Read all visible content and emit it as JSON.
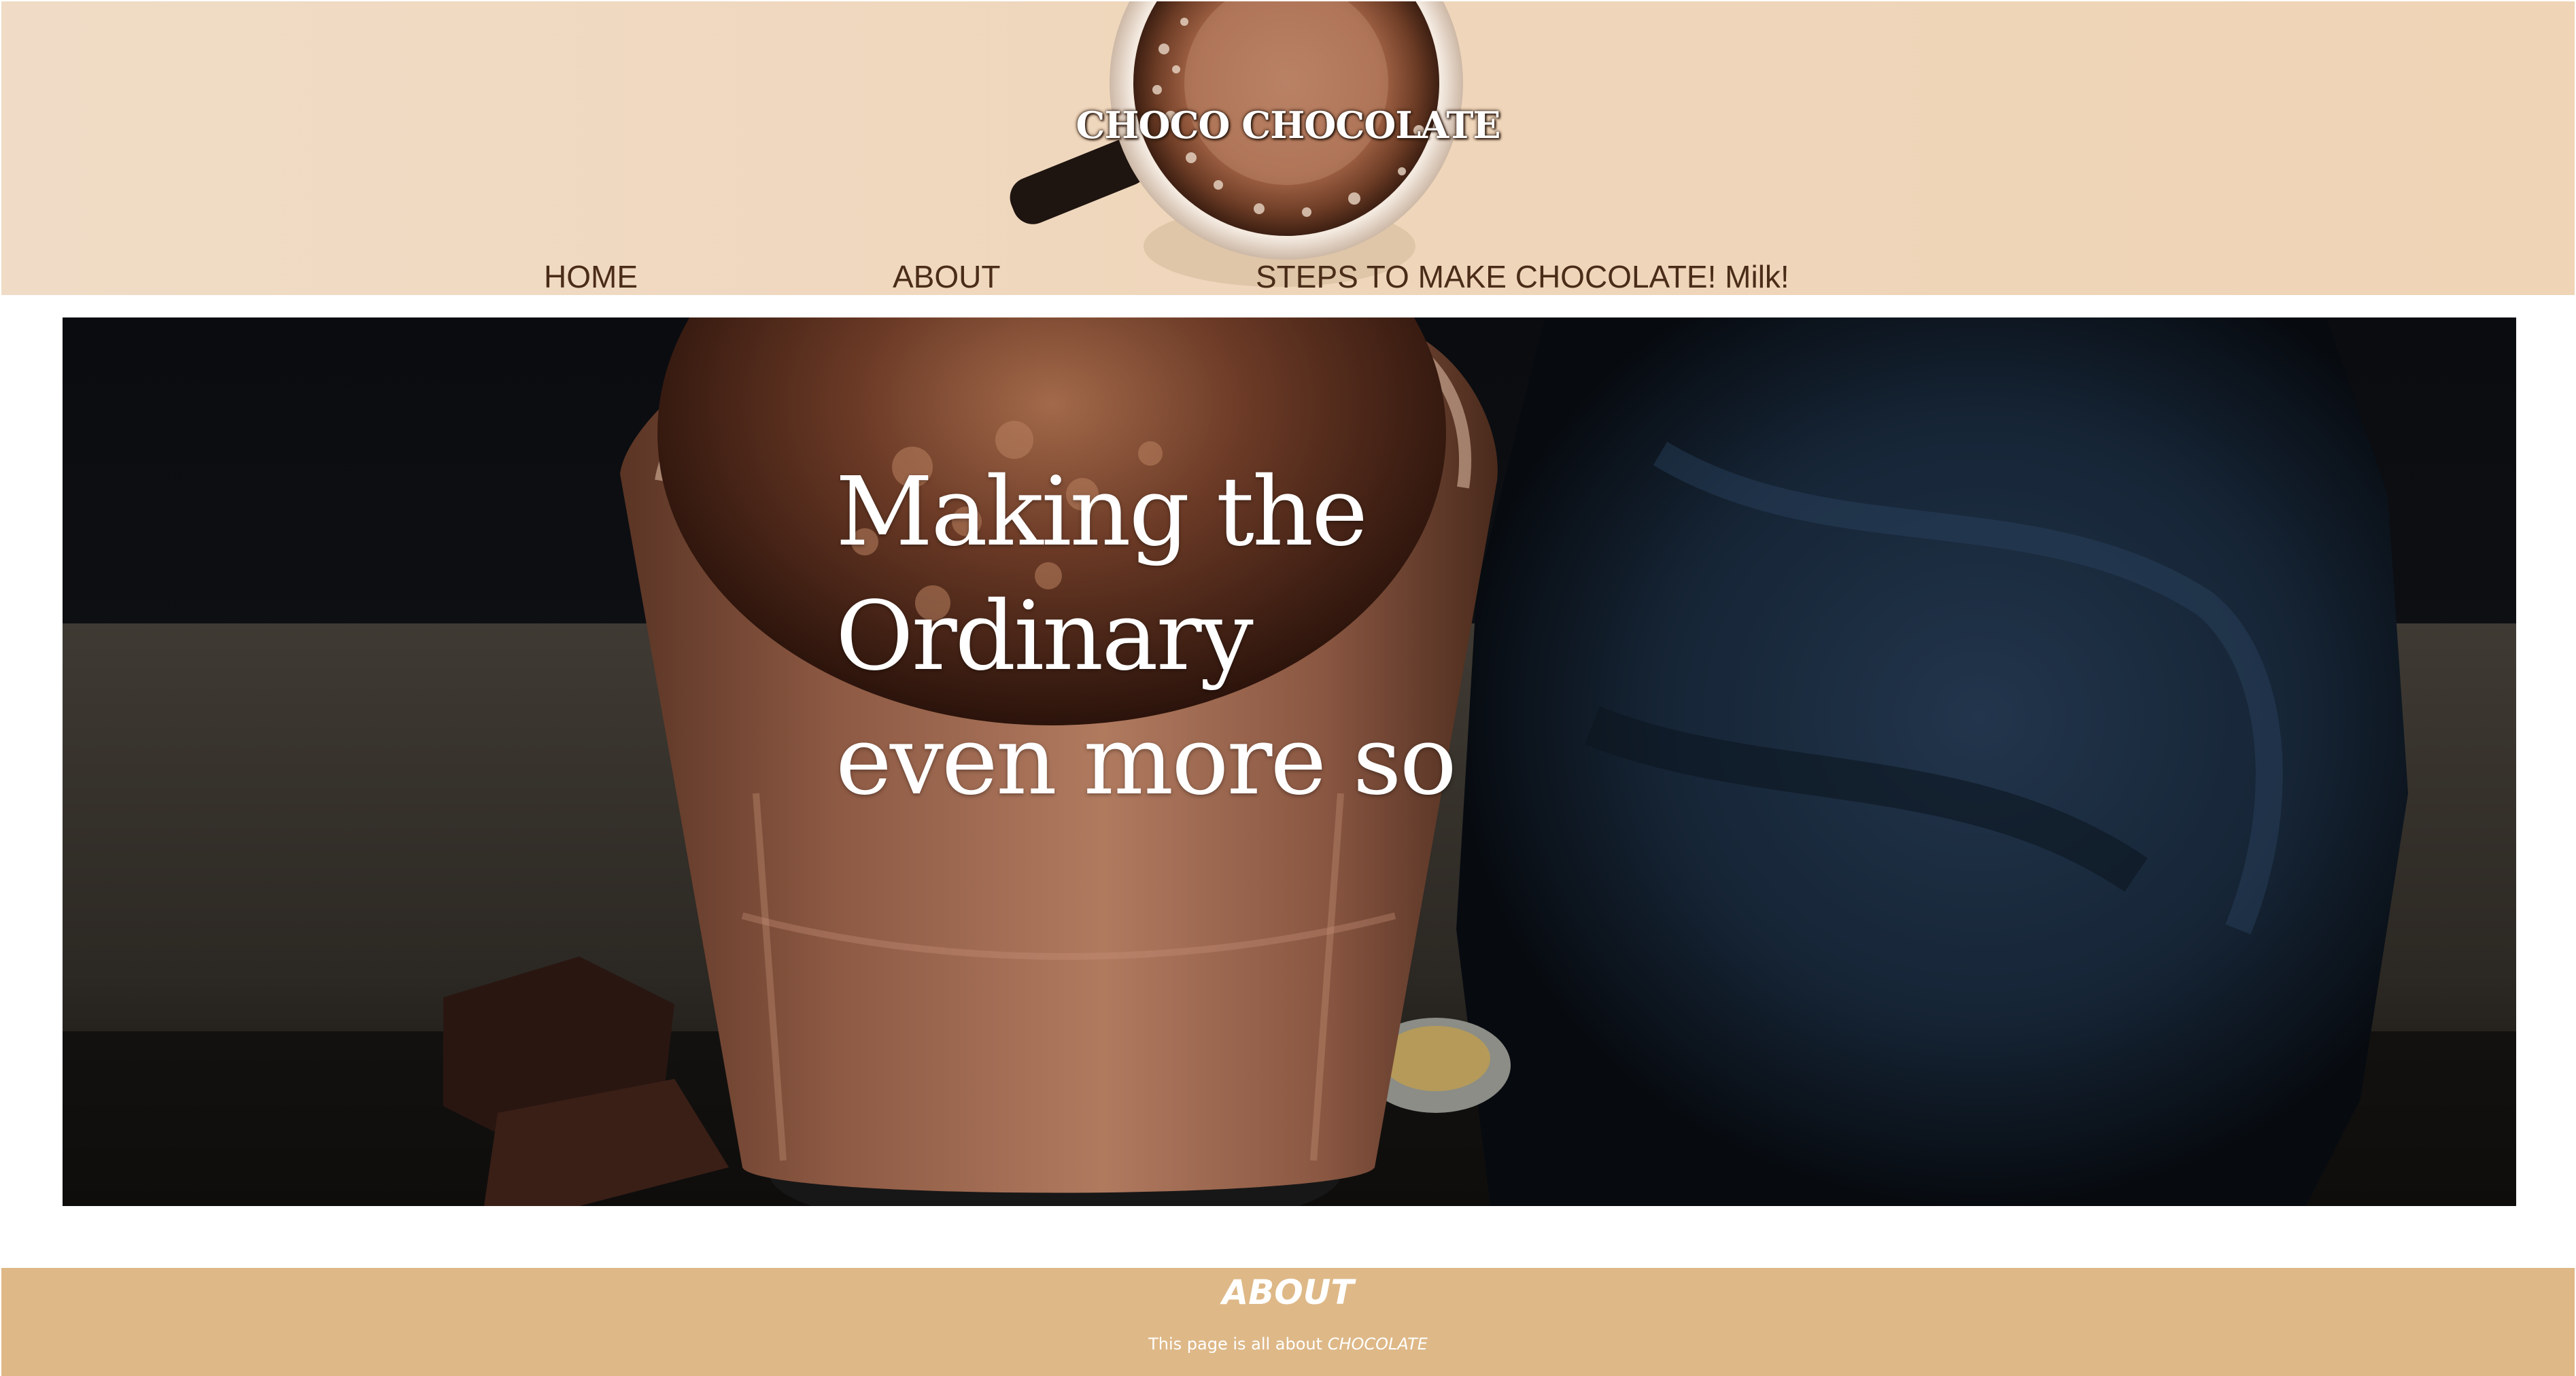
{
  "header": {
    "site_title": "CHOCO CHOCOLATE",
    "nav": {
      "home": "HOME",
      "about": "ABOUT",
      "steps": "STEPS TO MAKE CHOCOLATE! Milk!"
    }
  },
  "hero": {
    "headline_lines": [
      "Making the",
      "Ordinary",
      "even more so"
    ]
  },
  "footer": {
    "heading": "ABOUT",
    "text_prefix": "This page is all about ",
    "text_emphasis": "CHOCOLATE"
  },
  "colors": {
    "header_bg": "#efd6bb",
    "nav_text": "#4a2c18",
    "footer_bg": "#deb887",
    "hero_bg": "#06090d"
  }
}
